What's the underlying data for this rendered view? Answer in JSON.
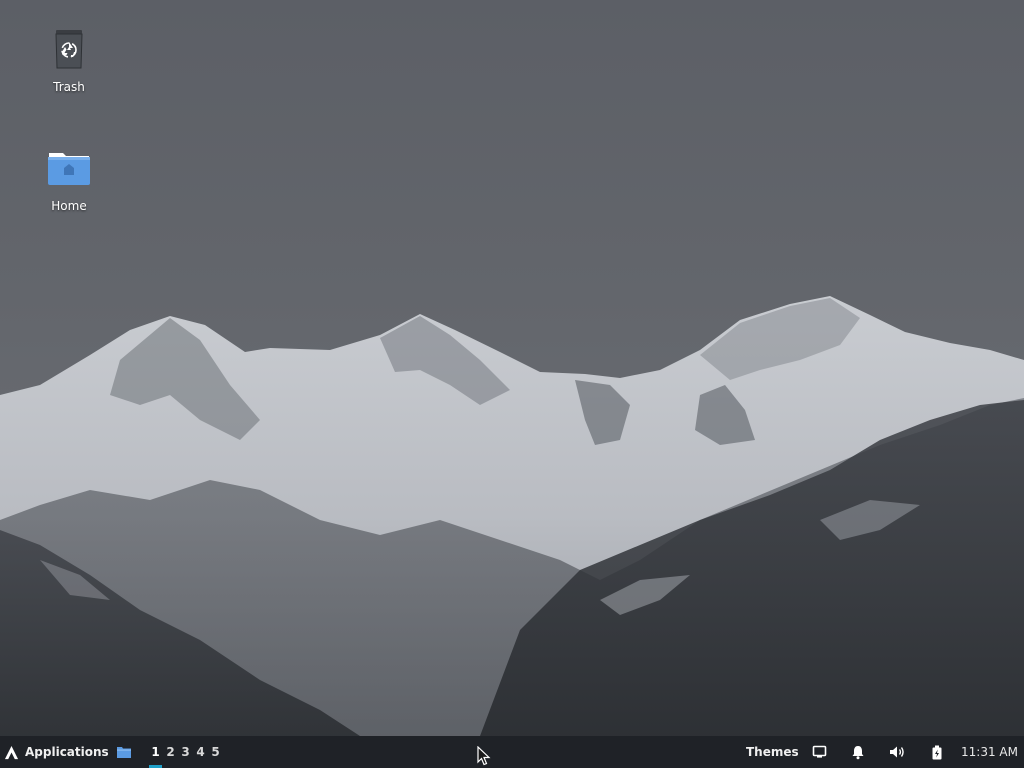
{
  "desktop": {
    "icons": [
      {
        "label": "Trash",
        "icon": "trash-icon"
      },
      {
        "label": "Home",
        "icon": "folder-home-icon"
      }
    ]
  },
  "panel": {
    "applications_label": "Applications",
    "workspaces": [
      "1",
      "2",
      "3",
      "4",
      "5"
    ],
    "active_workspace": "1",
    "themes_label": "Themes",
    "clock": "11:31 AM",
    "tray_icons": [
      "display-icon",
      "bell-icon",
      "volume-icon",
      "power-icon"
    ],
    "accent_color": "#1fa0c8",
    "background_color": "#1f2227"
  }
}
